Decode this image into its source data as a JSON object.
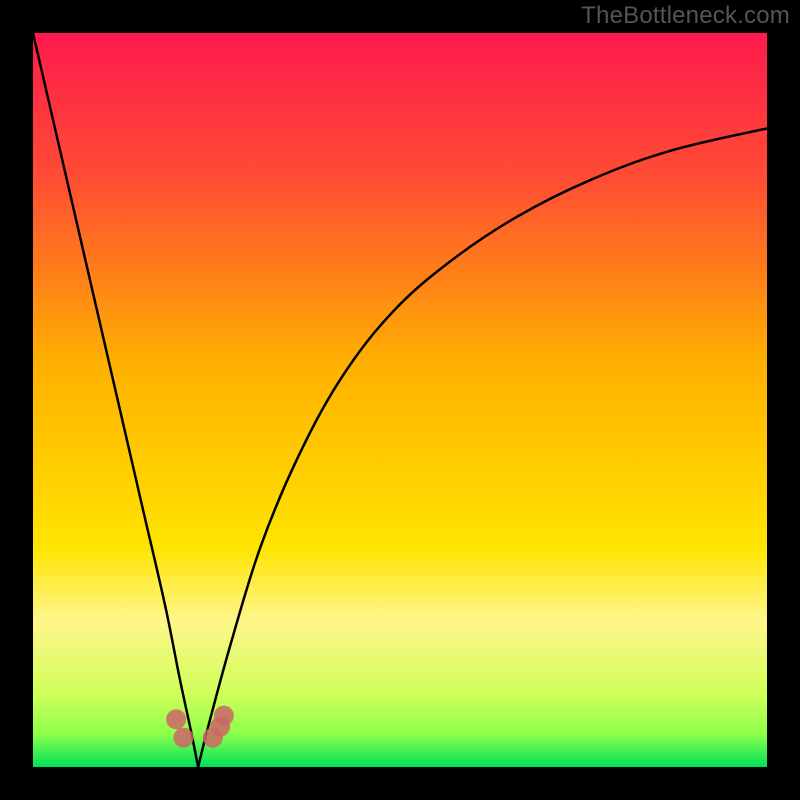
{
  "watermark": "TheBottleneck.com",
  "chart_data": {
    "type": "line",
    "title": "",
    "xlabel": "",
    "ylabel": "",
    "xlim": [
      0,
      1
    ],
    "ylim": [
      0,
      1
    ],
    "x_min_at": 0.225,
    "gradient_stops": [
      {
        "offset": 0.0,
        "color": "#ff1a4d"
      },
      {
        "offset": 0.2,
        "color": "#ff4d33"
      },
      {
        "offset": 0.45,
        "color": "#ffb000"
      },
      {
        "offset": 0.7,
        "color": "#ffe400"
      },
      {
        "offset": 0.8,
        "color": "#fff68a"
      },
      {
        "offset": 0.9,
        "color": "#cfff5a"
      },
      {
        "offset": 0.955,
        "color": "#8dff4a"
      },
      {
        "offset": 1.0,
        "color": "#00e05a"
      }
    ],
    "curve_left": {
      "x": [
        0.0,
        0.03,
        0.06,
        0.09,
        0.12,
        0.15,
        0.18,
        0.2,
        0.215,
        0.225
      ],
      "y": [
        1.0,
        0.87,
        0.74,
        0.61,
        0.48,
        0.35,
        0.22,
        0.12,
        0.05,
        0.0
      ]
    },
    "curve_right": {
      "x": [
        0.225,
        0.24,
        0.27,
        0.31,
        0.36,
        0.42,
        0.49,
        0.57,
        0.66,
        0.76,
        0.87,
        1.0
      ],
      "y": [
        0.0,
        0.06,
        0.17,
        0.3,
        0.42,
        0.53,
        0.62,
        0.69,
        0.75,
        0.8,
        0.84,
        0.87
      ]
    },
    "markers": {
      "x": [
        0.195,
        0.205,
        0.245,
        0.255,
        0.26
      ],
      "y": [
        0.065,
        0.04,
        0.04,
        0.055,
        0.07
      ]
    },
    "marker_color": "#cc6666",
    "curve_color": "#000000"
  }
}
